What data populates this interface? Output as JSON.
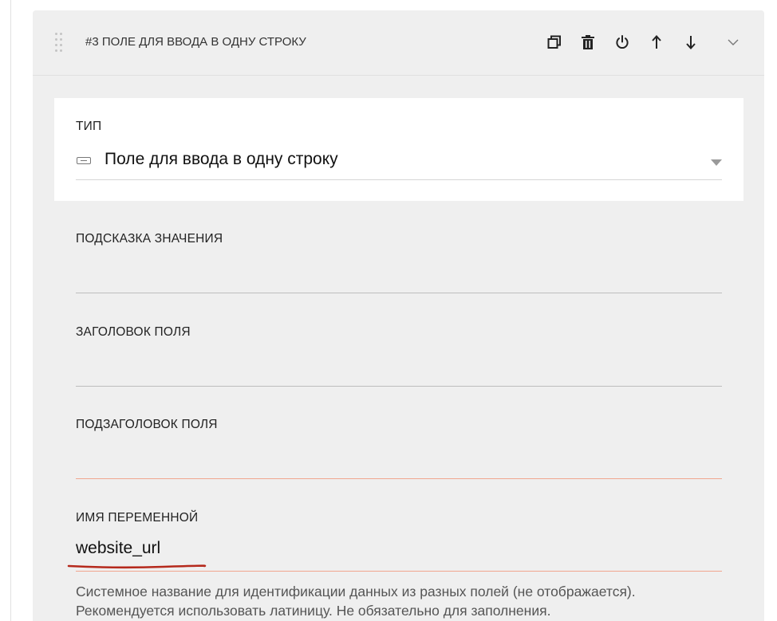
{
  "header": {
    "title": "#3 ПОЛЕ ДЛЯ ВВОДА В ОДНУ СТРОКУ",
    "actions": [
      "copy-icon",
      "trash-icon",
      "power-icon",
      "arrow-up-icon",
      "arrow-down-icon",
      "chevron-down-icon"
    ]
  },
  "type_field": {
    "label": "ТИП",
    "value": "Поле для ввода в одну строку",
    "icon": "input-field-icon"
  },
  "fields": {
    "hint": {
      "label": "ПОДСКАЗКА ЗНАЧЕНИЯ",
      "value": ""
    },
    "title": {
      "label": "ЗАГОЛОВОК ПОЛЯ",
      "value": ""
    },
    "subtitle": {
      "label": "ПОДЗАГОЛОВОК ПОЛЯ",
      "value": ""
    },
    "variable": {
      "label": "ИМЯ ПЕРЕМЕННОЙ",
      "value": "website_url",
      "help_line1": "Системное название для идентификации данных из разных полей (не отображается).",
      "help_line2": "Рекомендуется использовать латиницу. Не обязательно для заполнения."
    }
  },
  "colors": {
    "panel_bg": "#efefef",
    "accent_line": "#f1a68f",
    "annotation_red": "#b5291c"
  }
}
